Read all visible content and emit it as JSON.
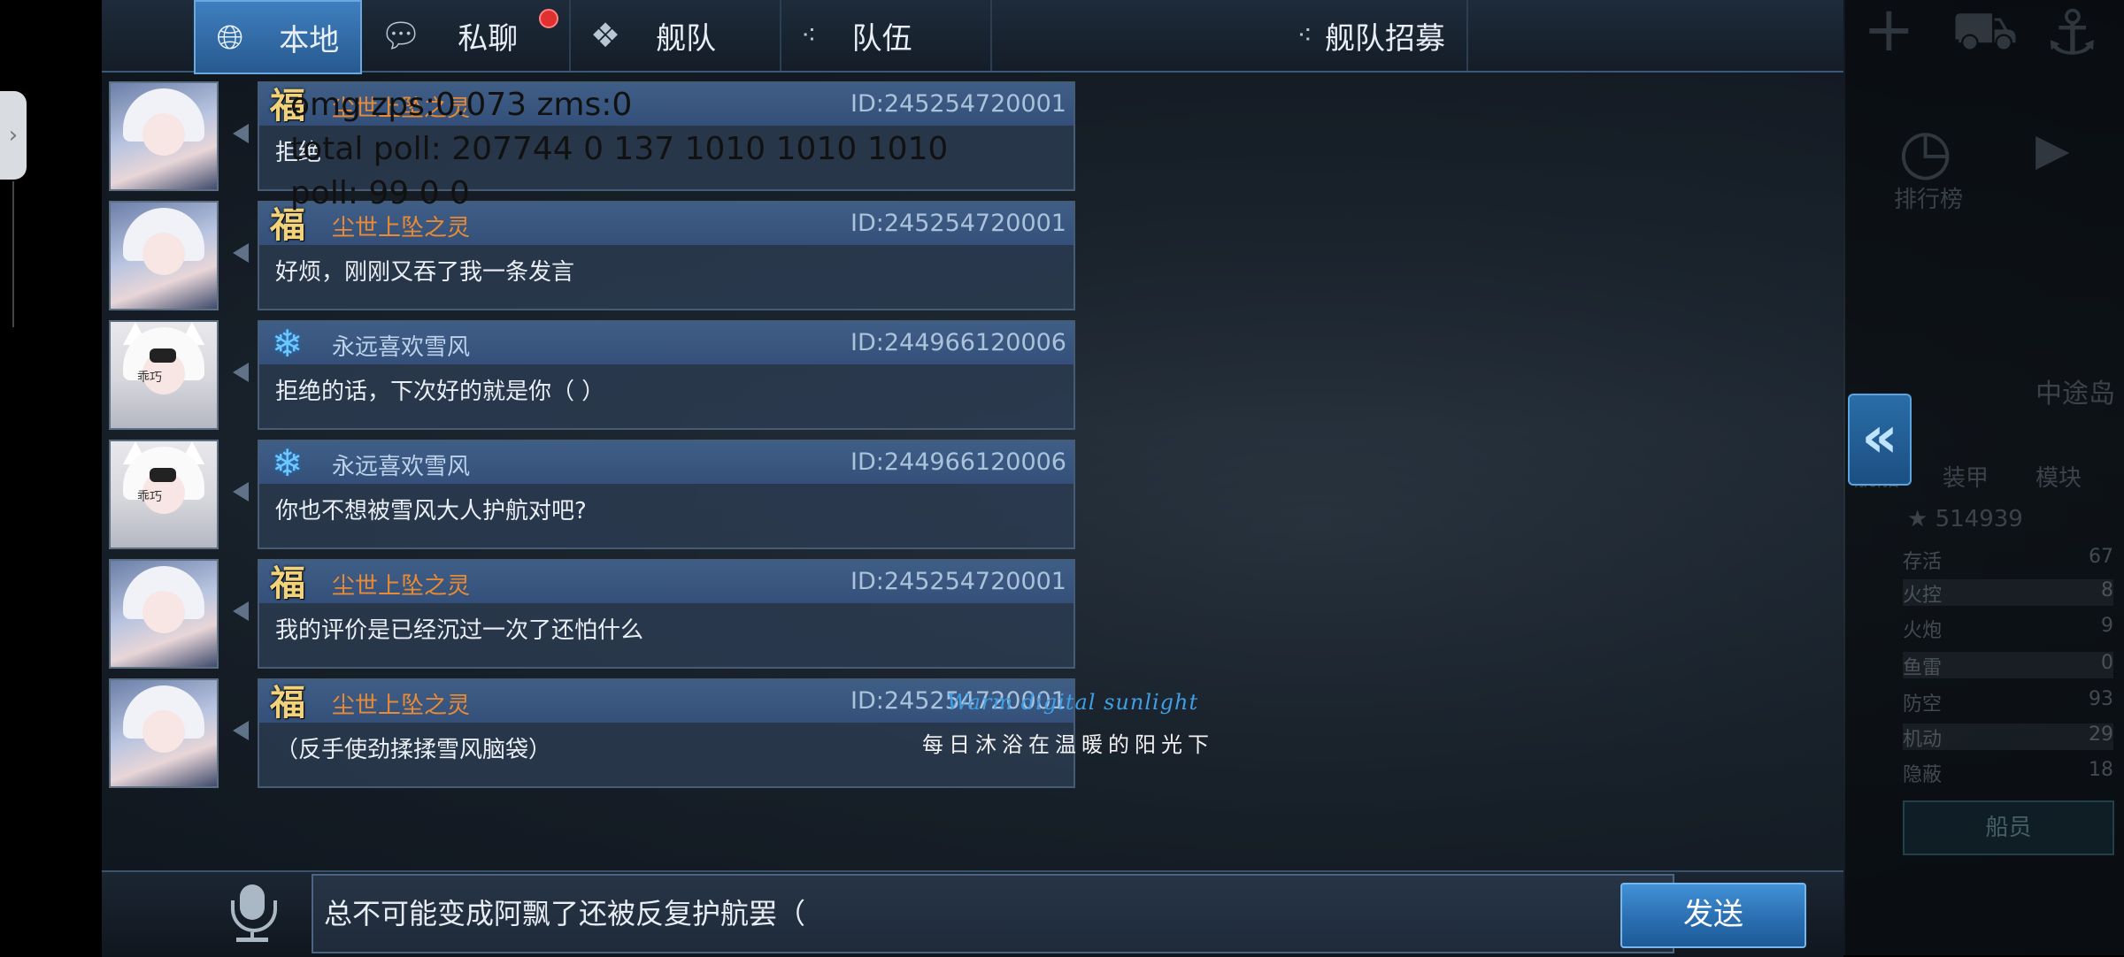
{
  "tabs": [
    {
      "label": "本地",
      "icon": "globe-icon",
      "active": true
    },
    {
      "label": "私聊",
      "icon": "chat-bubble-icon",
      "badge": true
    },
    {
      "label": "舰队",
      "icon": "fleet-emblem-icon"
    },
    {
      "label": "队伍",
      "icon": "team-dots-icon"
    },
    {
      "label": "舰队招募",
      "icon": "recruit-dots-icon"
    }
  ],
  "messages": [
    {
      "name": "尘世上坠之灵",
      "id": "ID:245254720001",
      "text": "拒绝",
      "badge": "福",
      "name_color": "gold"
    },
    {
      "name": "尘世上坠之灵",
      "id": "ID:245254720001",
      "text": "好烦，刚刚又吞了我一条发言",
      "badge": "福",
      "name_color": "gold"
    },
    {
      "name": "永远喜欢雪风",
      "id": "ID:244966120006",
      "text": "拒绝的话，下次好的就是你（ ）",
      "badge": "snowflake",
      "name_color": "blue",
      "avatar_tag": "乖巧"
    },
    {
      "name": "永远喜欢雪风",
      "id": "ID:244966120006",
      "text": "你也不想被雪风大人护航对吧?",
      "badge": "snowflake",
      "name_color": "blue",
      "avatar_tag": "乖巧"
    },
    {
      "name": "尘世上坠之灵",
      "id": "ID:245254720001",
      "text": "我的评价是已经沉过一次了还怕什么",
      "badge": "福",
      "name_color": "gold"
    },
    {
      "name": "尘世上坠之灵",
      "id": "ID:245254720001",
      "text": "（反手使劲揉揉雪风脑袋）",
      "badge": "福",
      "name_color": "gold"
    }
  ],
  "debug": {
    "line1": "omg zps:0.073 zms:0",
    "line2": "total poll: 207744 0 137 1010 1010 1010",
    "line3": "poll: 99 0 0"
  },
  "watermark": {
    "line1": "Warm digital sunlight",
    "line2": "每日沐浴在温暖的阳光下"
  },
  "input": {
    "value": "总不可能变成阿飘了还被反复护航罢（",
    "send_label": "发送"
  },
  "side_panel": {
    "ranking_label": "排行榜",
    "location": "中途岛",
    "tabs": [
      "舰船",
      "装甲",
      "模块"
    ],
    "rating": "514939",
    "stats": [
      {
        "label": "存活",
        "value": "67"
      },
      {
        "label": "火控",
        "value": "8"
      },
      {
        "label": "火炮",
        "value": "9"
      },
      {
        "label": "鱼雷",
        "value": "0"
      },
      {
        "label": "防空",
        "value": "93"
      },
      {
        "label": "机动",
        "value": "29"
      },
      {
        "label": "隐蔽",
        "value": "18"
      }
    ],
    "crew_button": "船员",
    "expand_icon": "double-chevron-left-icon"
  },
  "colors": {
    "accent_blue": "#3f7fbf",
    "name_gold": "#e98a34",
    "badge_red": "#e03030",
    "send_button": "#2a6fb1"
  }
}
